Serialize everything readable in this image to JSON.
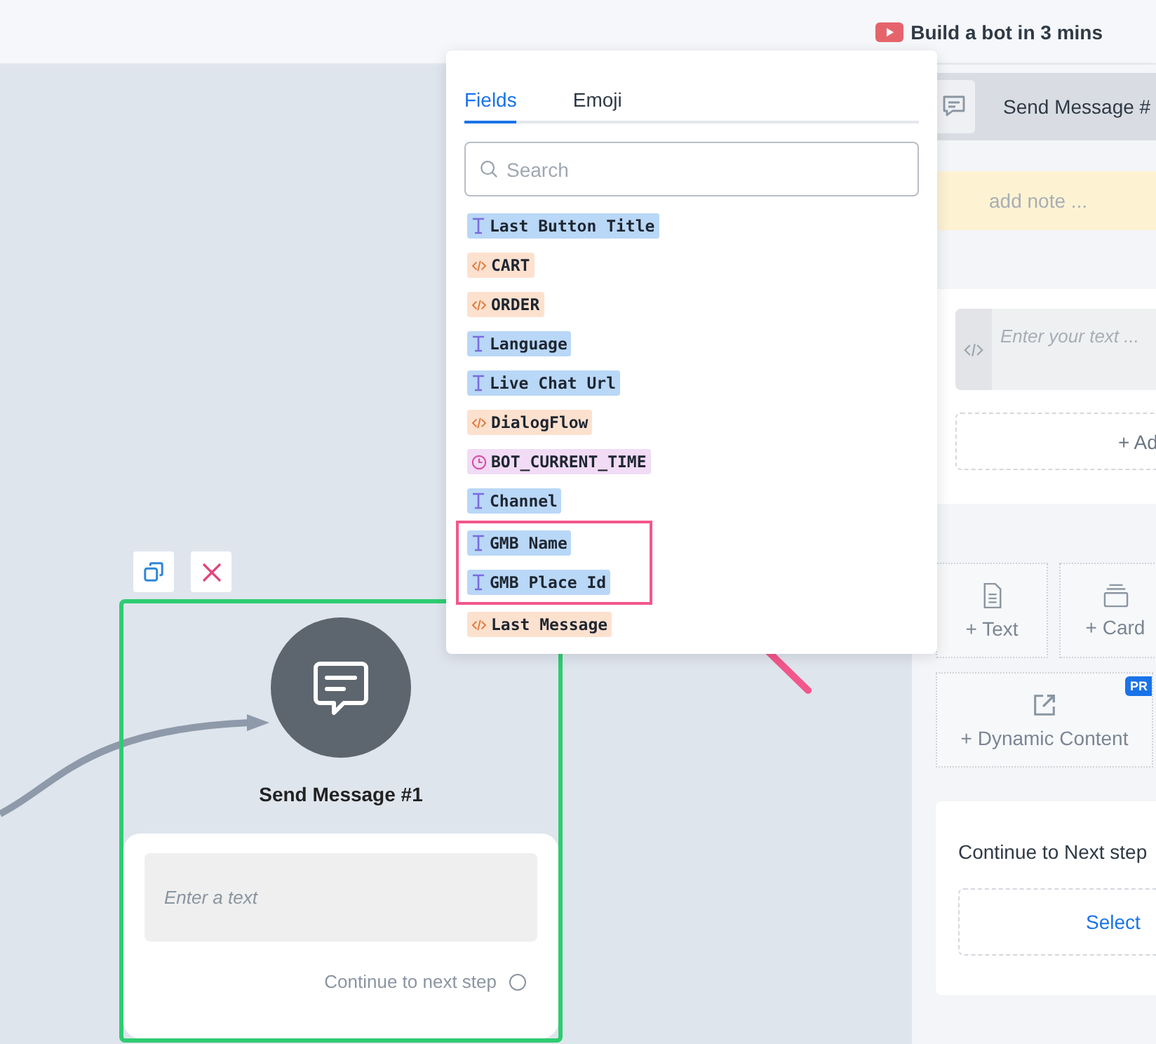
{
  "top_bar": {
    "video_link": "Build a bot in 3 mins"
  },
  "canvas": {
    "node": {
      "title": "Send Message #1",
      "placeholder": "Enter a text",
      "continue_label": "Continue to next step",
      "continue_checked": false
    }
  },
  "variable_picker": {
    "tabs": [
      {
        "label": "Fields",
        "selected": true
      },
      {
        "label": "Emoji",
        "selected": false
      }
    ],
    "search": {
      "placeholder": "Search"
    },
    "fields": [
      {
        "label": "Last Button Title",
        "kind": "text"
      },
      {
        "label": "CART",
        "kind": "code"
      },
      {
        "label": "ORDER",
        "kind": "code"
      },
      {
        "label": "Language",
        "kind": "text"
      },
      {
        "label": "Live Chat Url",
        "kind": "text"
      },
      {
        "label": "DialogFlow",
        "kind": "code"
      },
      {
        "label": "BOT_CURRENT_TIME",
        "kind": "time"
      },
      {
        "label": "Channel",
        "kind": "text"
      },
      {
        "kind": "highlight",
        "items": [
          {
            "label": "GMB Name",
            "kind": "text"
          },
          {
            "label": "GMB Place Id",
            "kind": "text"
          }
        ]
      },
      {
        "label": "Last Message",
        "kind": "code"
      }
    ]
  },
  "side_panel": {
    "title": "Send Message #",
    "note_placeholder": "add note ...",
    "text_placeholder": "Enter your text ...",
    "add_button": "+ Ad",
    "content_buttons": [
      {
        "label": "+ Text",
        "kind": "text"
      },
      {
        "label": "+ Card",
        "kind": "card"
      },
      {
        "label": "+ Dynamic Content",
        "kind": "dynamic",
        "badge": "PR"
      }
    ],
    "next_step": {
      "label": "Continue to Next step",
      "select": "Select"
    }
  }
}
